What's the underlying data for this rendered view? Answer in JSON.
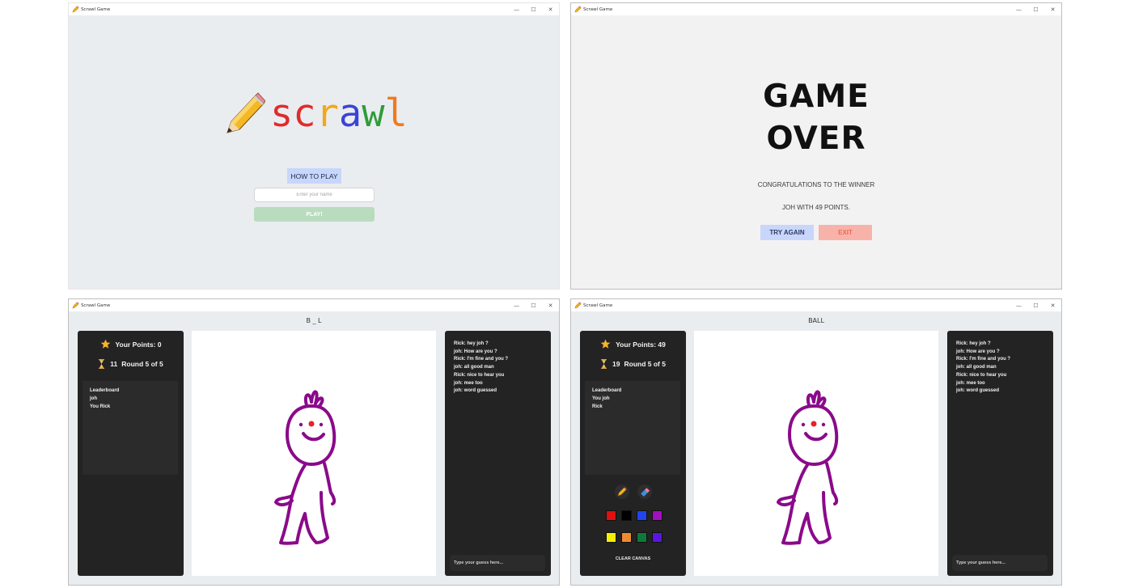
{
  "window_title": "Scrawl Game",
  "controls": {
    "minimize": "—",
    "maximize": "☐",
    "close": "✕"
  },
  "home": {
    "logo_letters": [
      {
        "ch": "s",
        "color": "#e12b2b"
      },
      {
        "ch": "c",
        "color": "#e12b2b"
      },
      {
        "ch": "r",
        "color": "#f2a81a"
      },
      {
        "ch": "a",
        "color": "#3b44d6"
      },
      {
        "ch": "w",
        "color": "#2f9c3a"
      },
      {
        "ch": "l",
        "color": "#f07a1e"
      }
    ],
    "how_to_play": "HOW TO PLAY",
    "name_placeholder": "Enter your name",
    "play": "PLAY!"
  },
  "gameover": {
    "line1": "GAME",
    "line2": "OVER",
    "congrats": "CONGRATULATIONS TO THE WINNER",
    "winner": "JOH WITH 49 POINTS.",
    "try_again": "TRY AGAIN",
    "exit": "EXIT"
  },
  "guesser": {
    "word": "B _ L",
    "points": "Your Points: 0",
    "timer": "11",
    "round": "Round 5 of 5",
    "leaderboard": [
      "Leaderboard",
      "joh",
      "You Rick"
    ],
    "chat": [
      "Rick: hey joh ?",
      "joh: How are you ?",
      "Rick: I'm fine and you ?",
      "joh: all good man",
      "Rick: nice to hear you",
      "joh: mee too",
      "joh: word guessed"
    ],
    "guess_placeholder": "Type your guess here..."
  },
  "drawer": {
    "word": "BALL",
    "points": "Your Points: 49",
    "timer": "19",
    "round": "Round 5 of 5",
    "leaderboard": [
      "Leaderboard",
      "You joh",
      "Rick"
    ],
    "chat": [
      "Rick: hey joh ?",
      "joh: How are you ?",
      "Rick: I'm fine and you ?",
      "joh: all good man",
      "Rick: nice to hear you",
      "joh: mee too",
      "joh: word guessed"
    ],
    "guess_placeholder": "Type your guess here...",
    "tools": [
      {
        "icon": "pencil-icon"
      },
      {
        "icon": "eraser-icon"
      }
    ],
    "colors_row1": [
      "#e01010",
      "#000000",
      "#2244ee",
      "#a010c0"
    ],
    "colors_row2": [
      "#f5f000",
      "#f08a30",
      "#0d7a3a",
      "#5a16e0"
    ],
    "clear_canvas": "CLEAR CANVAS"
  },
  "colors": {
    "drawing_stroke": "#8a0a8a",
    "nose": "#e8202a",
    "dark_panel": "#232323",
    "how_to_bg": "#c8d6fb",
    "play_bg": "#b9dcbf",
    "exit_bg": "#f7b3a9"
  }
}
